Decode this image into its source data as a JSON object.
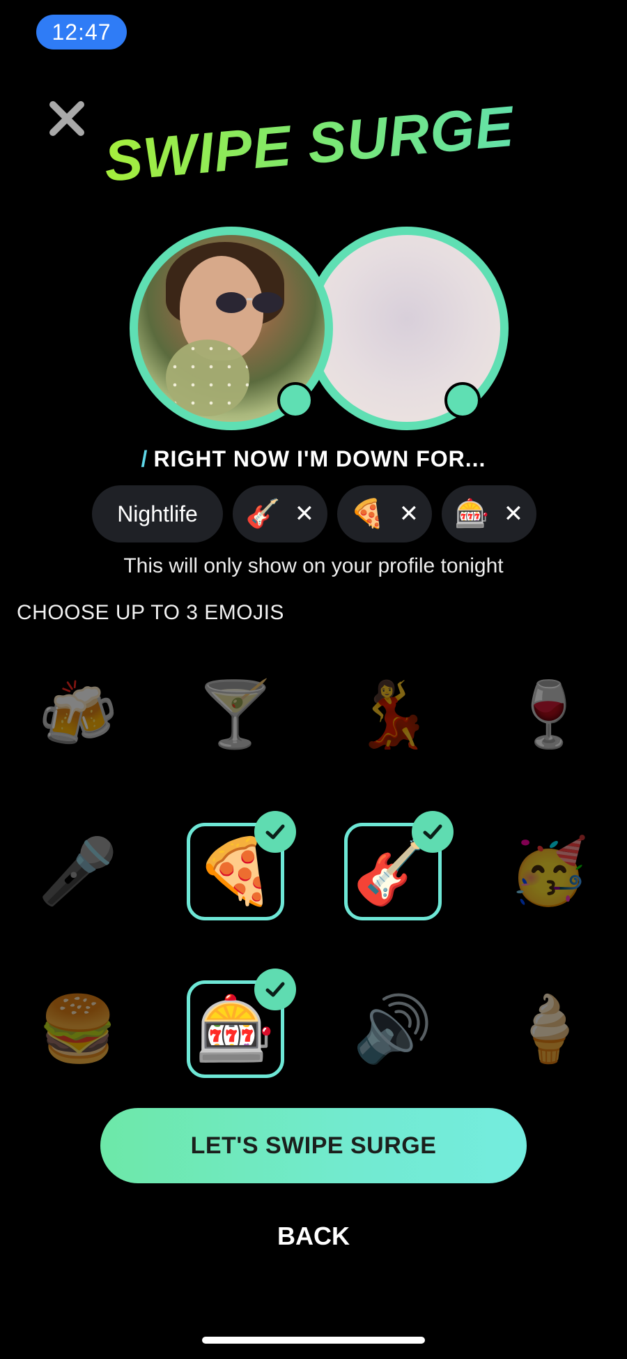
{
  "status_bar": {
    "time": "12:47"
  },
  "header": {
    "title": "SWIPE SURGE"
  },
  "subtitle": {
    "slash": "/",
    "text": "RIGHT NOW I'M DOWN FOR..."
  },
  "chips": [
    {
      "label": "Nightlife"
    },
    {
      "emoji": "🎸",
      "remove": "✕"
    },
    {
      "emoji": "🍕",
      "remove": "✕"
    },
    {
      "emoji": "🎰",
      "remove": "✕"
    }
  ],
  "note": "This will only show on your profile tonight",
  "choose_label": "CHOOSE UP TO 3 EMOJIS",
  "emoji_grid": [
    {
      "emoji": "🍻",
      "name": "beers",
      "selected": false
    },
    {
      "emoji": "🍸",
      "name": "martini",
      "selected": false
    },
    {
      "emoji": "💃",
      "name": "dancer",
      "selected": false
    },
    {
      "emoji": "🍷",
      "name": "wine",
      "selected": false
    },
    {
      "emoji": "🎤",
      "name": "microphone",
      "selected": false
    },
    {
      "emoji": "🍕",
      "name": "pizza",
      "selected": true
    },
    {
      "emoji": "🎸",
      "name": "guitar",
      "selected": true
    },
    {
      "emoji": "🥳",
      "name": "party-face",
      "selected": false
    },
    {
      "emoji": "🍔",
      "name": "burger",
      "selected": false
    },
    {
      "emoji": "🎰",
      "name": "slot-machine",
      "selected": true
    },
    {
      "emoji": "🔊",
      "name": "speaker",
      "selected": false
    },
    {
      "emoji": "🍦",
      "name": "ice-cream",
      "selected": false
    }
  ],
  "cta": {
    "label": "LET'S SWIPE SURGE"
  },
  "back": {
    "label": "BACK"
  },
  "colors": {
    "accent": "#5fdfb3",
    "selected_border": "#6ee7d6",
    "chip_bg": "#1f2126",
    "status_pill": "#2f7cf6"
  }
}
